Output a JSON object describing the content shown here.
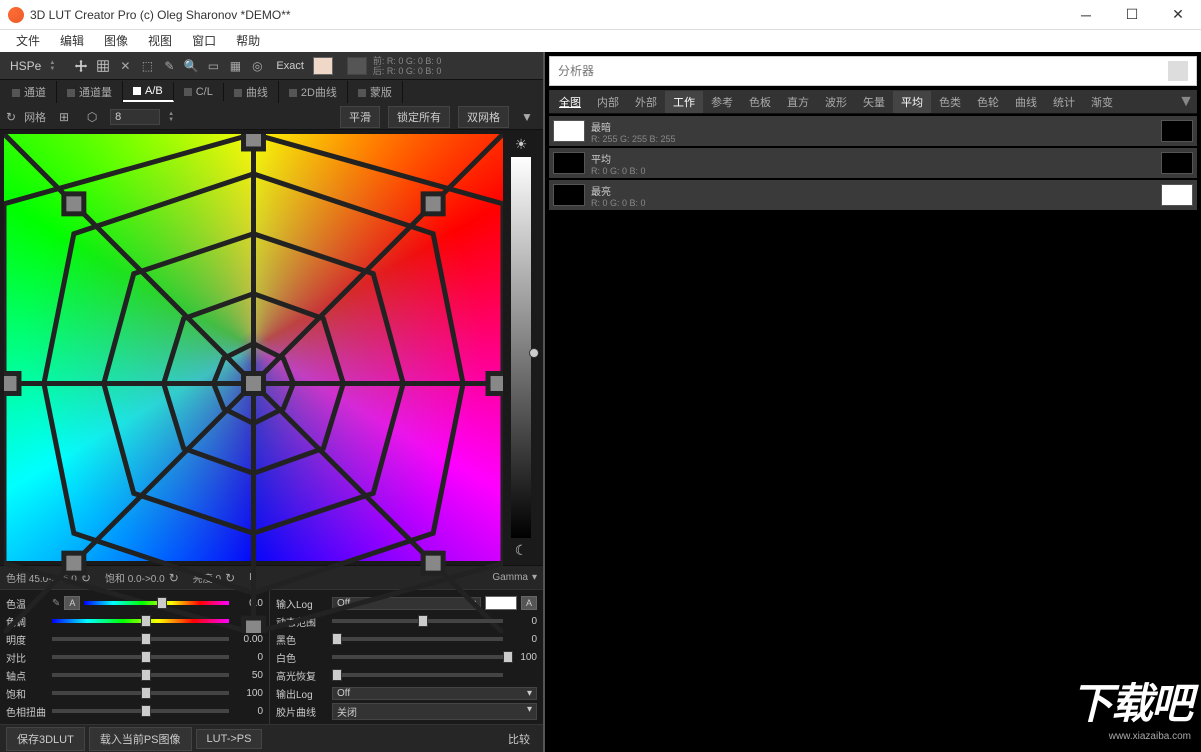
{
  "window": {
    "title": "3D LUT Creator Pro (c) Oleg Sharonov *DEMO**"
  },
  "menu": {
    "file": "文件",
    "edit": "编辑",
    "image": "图像",
    "view": "视图",
    "window": "窗口",
    "help": "帮助"
  },
  "toolbar": {
    "hspe": "HSPe",
    "exact": "Exact",
    "rgb_before": "前: R: 0   G: 0   B: 0",
    "rgb_after": "后: R: 0   G: 0   B: 0"
  },
  "tabs": {
    "channel": "通道",
    "channel_amt": "通道量",
    "ab": "A/B",
    "cl": "C/L",
    "curve": "曲线",
    "curve2d": "2D曲线",
    "mask": "蒙版"
  },
  "grid": {
    "label": "网格",
    "value": "8",
    "smooth": "平滑",
    "lockall": "锁定所有",
    "dualgrid": "双网格"
  },
  "valbar": {
    "hue": "色相 45.0->45.0",
    "sat": "饱和 0.0->0.0",
    "bright": "亮度  0",
    "l": "L",
    "gamma": "Gamma"
  },
  "sliders_left": [
    {
      "label": "色温",
      "value": "0.0",
      "pos": 50,
      "rainbow": true,
      "eyedrop": true,
      "abtn": true
    },
    {
      "label": "色调",
      "value": "0.0",
      "pos": 50,
      "rainbow": true
    },
    {
      "label": "明度",
      "value": "0.00",
      "pos": 50
    },
    {
      "label": "对比",
      "value": "0",
      "pos": 50
    },
    {
      "label": "轴点",
      "value": "50",
      "pos": 50
    },
    {
      "label": "饱和",
      "value": "100",
      "pos": 50
    },
    {
      "label": "色相扭曲",
      "value": "0",
      "pos": 50
    }
  ],
  "sliders_right": [
    {
      "label": "输入Log",
      "type": "dd",
      "value": "Off",
      "abtn": true,
      "swatch": true
    },
    {
      "label": "动态范围",
      "value": "0",
      "pos": 50
    },
    {
      "label": "黑色",
      "value": "0",
      "pos": 0
    },
    {
      "label": "白色",
      "value": "100",
      "pos": 100
    },
    {
      "label": "高光恢复",
      "value": "",
      "pos": 0
    },
    {
      "label": "输出Log",
      "type": "dd",
      "value": "Off"
    },
    {
      "label": "胶片曲线",
      "type": "dd",
      "value": "关闭"
    }
  ],
  "bottom": {
    "save": "保存3DLUT",
    "loadps": "载入当前PS图像",
    "lutps": "LUT->PS",
    "compare": "比较"
  },
  "right": {
    "search_placeholder": "分析器",
    "tabs": [
      "全图",
      "内部",
      "外部",
      "工作",
      "参考",
      "色板",
      "直方",
      "波形",
      "矢量",
      "平均",
      "色类",
      "色轮",
      "曲线",
      "统计",
      "渐变"
    ],
    "tab_sel": 0,
    "tab_high1": 3,
    "tab_high2": 9,
    "items": [
      {
        "name": "最暗",
        "rgb": "R: 255  G: 255  B: 255",
        "c1": "#ffffff",
        "c2": "#000000"
      },
      {
        "name": "平均",
        "rgb": "R: 0   G: 0   B: 0",
        "c1": "#000000",
        "c2": "#000000"
      },
      {
        "name": "最亮",
        "rgb": "R: 0   G: 0   B: 0",
        "c1": "#000000",
        "c2": "#ffffff"
      }
    ]
  },
  "watermark": {
    "big": "下载吧",
    "url": "www.xiazaiba.com"
  }
}
